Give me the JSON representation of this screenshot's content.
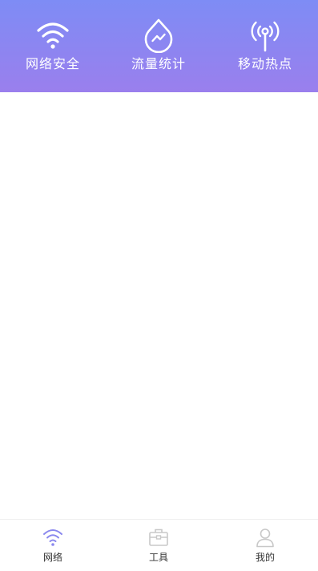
{
  "header": {
    "items": [
      {
        "label": "网络安全",
        "icon": "wifi-icon"
      },
      {
        "label": "流量统计",
        "icon": "data-drop-icon"
      },
      {
        "label": "移动热点",
        "icon": "hotspot-antenna-icon"
      }
    ]
  },
  "tabbar": {
    "items": [
      {
        "label": "网络",
        "icon": "wifi-icon",
        "active": true
      },
      {
        "label": "工具",
        "icon": "toolbox-icon",
        "active": false
      },
      {
        "label": "我的",
        "icon": "user-icon",
        "active": false
      }
    ]
  },
  "colors": {
    "header_gradient_start": "#7e8cf5",
    "header_gradient_end": "#9a7fed",
    "tab_active_icon": "#8a88ee",
    "tab_inactive_icon": "#c8c8c8"
  }
}
